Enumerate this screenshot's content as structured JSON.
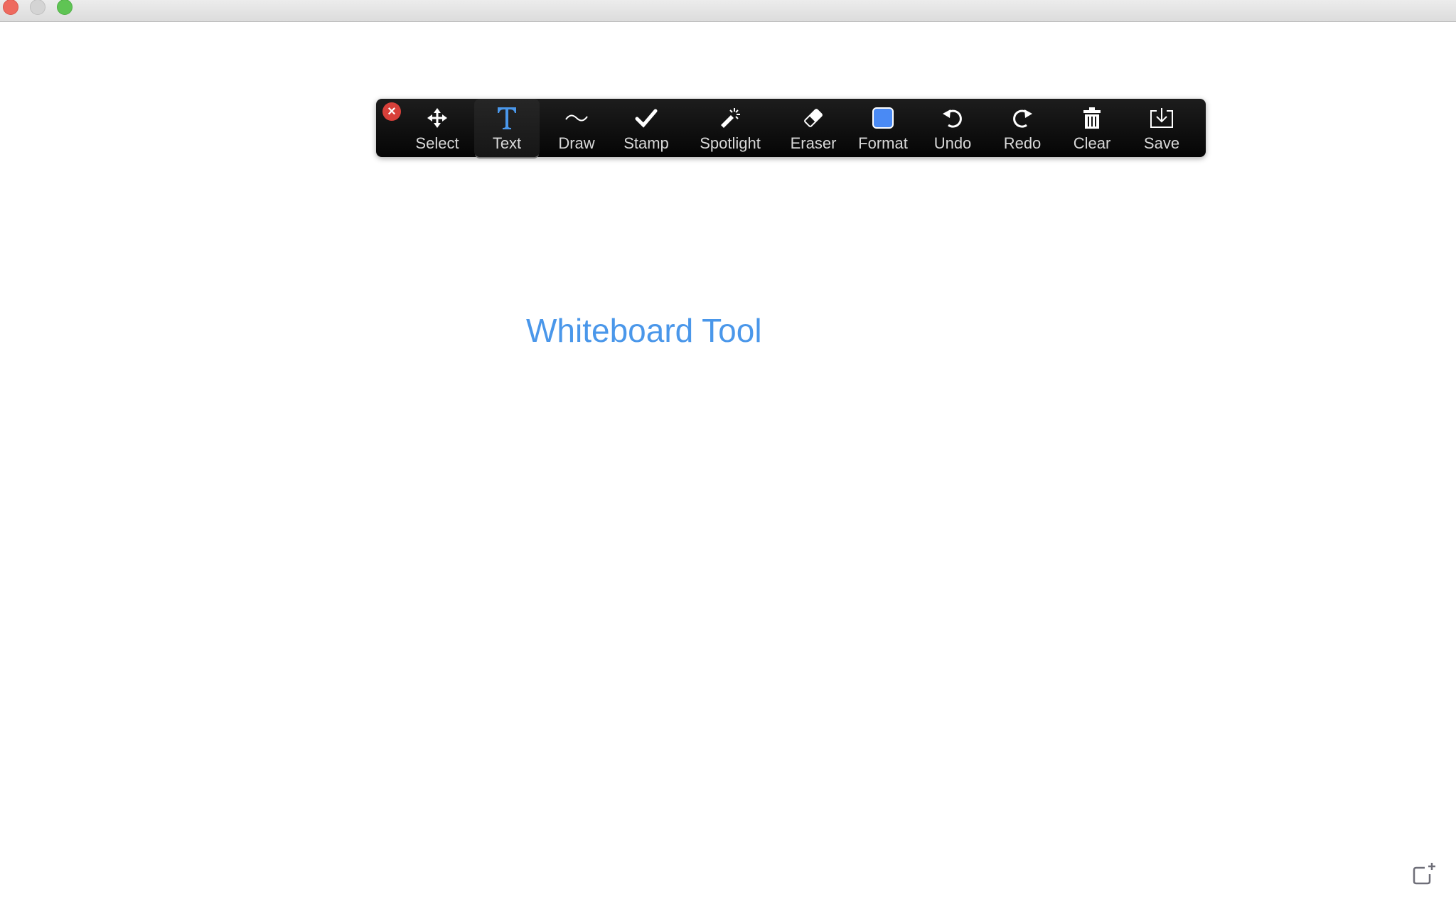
{
  "window": {
    "controls": [
      "close",
      "minimize",
      "maximize"
    ]
  },
  "toolbar": {
    "close_icon": "×",
    "active_tool": "Text",
    "tools": [
      {
        "id": "select",
        "label": "Select",
        "icon": "move-arrows-icon"
      },
      {
        "id": "text",
        "label": "Text",
        "icon": "text-T-icon"
      },
      {
        "id": "draw",
        "label": "Draw",
        "icon": "squiggle-icon"
      },
      {
        "id": "stamp",
        "label": "Stamp",
        "icon": "checkmark-icon"
      },
      {
        "id": "spotlight",
        "label": "Spotlight",
        "icon": "magic-wand-icon"
      },
      {
        "id": "eraser",
        "label": "Eraser",
        "icon": "eraser-icon"
      },
      {
        "id": "format",
        "label": "Format",
        "icon": "color-swatch-icon"
      },
      {
        "id": "undo",
        "label": "Undo",
        "icon": "undo-icon"
      },
      {
        "id": "redo",
        "label": "Redo",
        "icon": "redo-icon"
      },
      {
        "id": "clear",
        "label": "Clear",
        "icon": "trash-icon"
      },
      {
        "id": "save",
        "label": "Save",
        "icon": "save-download-icon"
      }
    ],
    "colors": {
      "active_text_icon": "#4a97ea",
      "format_swatch": "#4a8af4",
      "close_button": "#d8403a"
    }
  },
  "canvas": {
    "text": "Whiteboard Tool",
    "text_color": "#4a97ea"
  },
  "corner_button": {
    "icon": "new-whiteboard-icon"
  }
}
